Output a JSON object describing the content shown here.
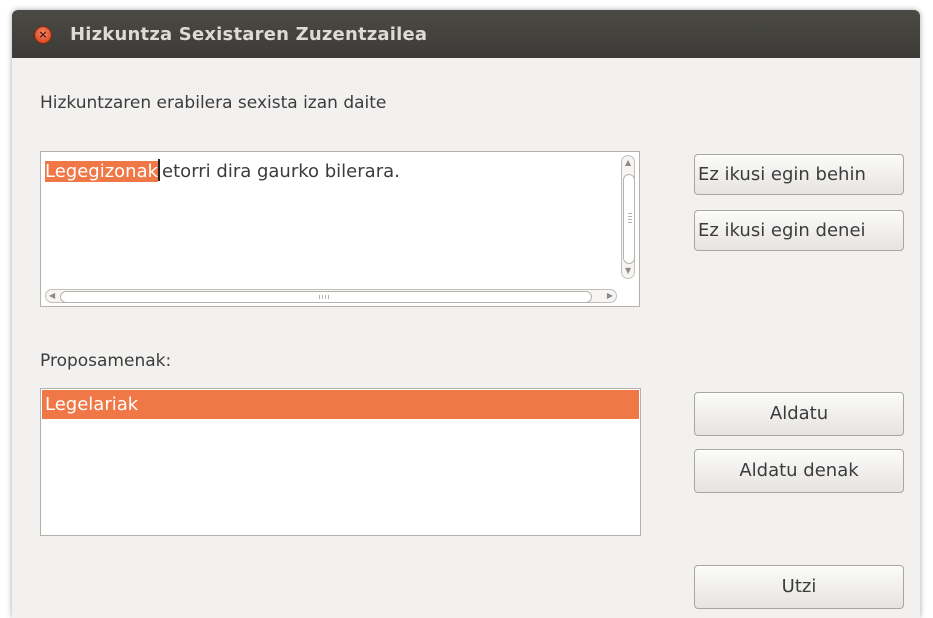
{
  "window": {
    "title": "Hizkuntza Sexistaren Zuzentzailea",
    "close_icon": "×"
  },
  "message": "Hizkuntzaren erabilera sexista izan daite",
  "text_area": {
    "highlighted_word": "Legegizonak",
    "rest_text": "etorri dira gaurko bilerara."
  },
  "suggestions": {
    "label": "Proposamenak:",
    "items": [
      "Legelariak"
    ]
  },
  "buttons": {
    "ignore_once": "Ez ikusi egin behin",
    "ignore_all": "Ez ikusi egin denei",
    "change": "Aldatu",
    "change_all": "Aldatu denak",
    "cancel": "Utzi"
  },
  "colors": {
    "highlight": "#f07746",
    "titlebar": "#3c3b37",
    "background": "#f2f1f0"
  }
}
